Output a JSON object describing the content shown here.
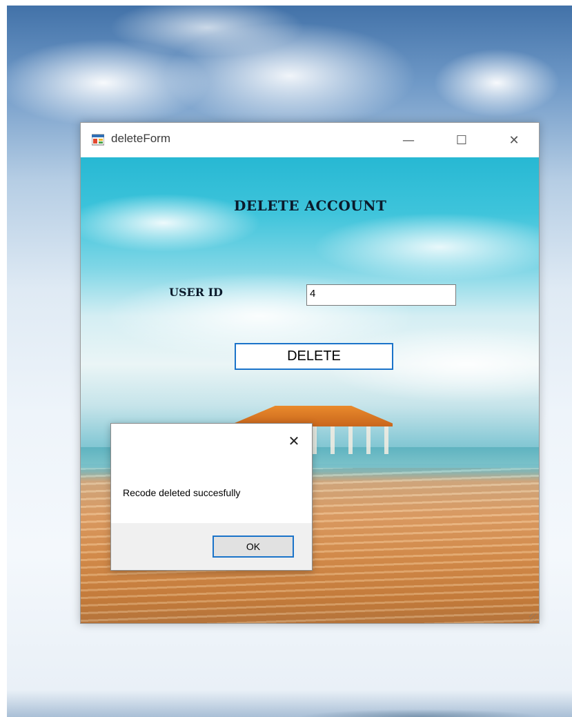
{
  "window": {
    "title": "deleteForm",
    "controls": {
      "minimize_icon": "—",
      "maximize_icon": "☐",
      "close_icon": "✕"
    }
  },
  "form": {
    "heading": "DELETE ACCOUNT",
    "user_id_label": "USER ID",
    "user_id_value": "4",
    "delete_button_label": "DELETE"
  },
  "message_box": {
    "close_icon": "✕",
    "message": "Recode deleted succesfully",
    "ok_button_label": "OK"
  },
  "colors": {
    "focus_border": "#1a73c9",
    "dialog_footer": "#f0f0f0"
  }
}
